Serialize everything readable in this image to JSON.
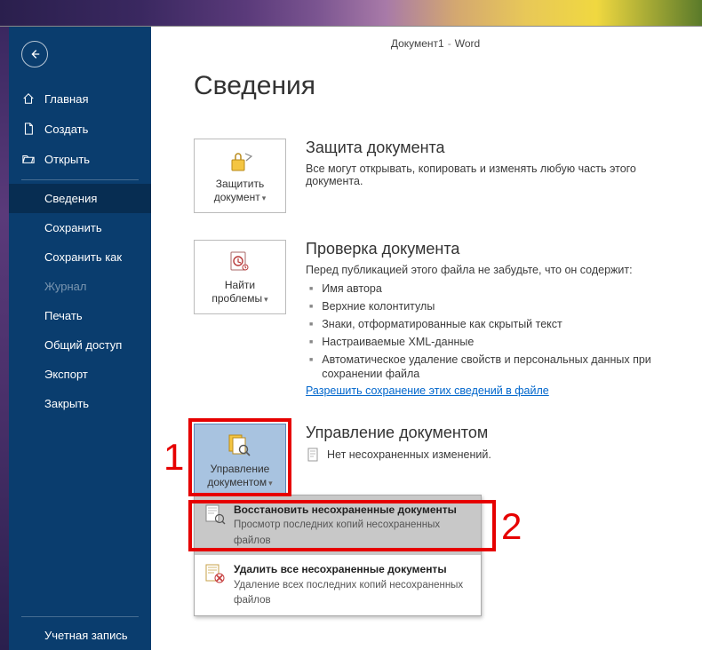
{
  "titlebar": {
    "doc": "Документ1",
    "separator": "-",
    "app": "Word"
  },
  "sidebar": {
    "home": "Главная",
    "new": "Создать",
    "open": "Открыть",
    "info": "Сведения",
    "save": "Сохранить",
    "saveas": "Сохранить как",
    "history": "Журнал",
    "print": "Печать",
    "share": "Общий доступ",
    "export": "Экспорт",
    "close": "Закрыть",
    "account": "Учетная запись"
  },
  "page": {
    "title": "Сведения"
  },
  "protect": {
    "tile_label": "Защитить документ",
    "heading": "Защита документа",
    "body": "Все могут открывать, копировать и изменять любую часть этого документа."
  },
  "inspect": {
    "tile_label": "Найти проблемы",
    "heading": "Проверка документа",
    "body": "Перед публикацией этого файла не забудьте, что он содержит:",
    "items": [
      "Имя автора",
      "Верхние колонтитулы",
      "Знаки, отформатированные как скрытый текст",
      "Настраиваемые XML-данные",
      "Автоматическое удаление свойств и персональных данных при сохранении файла"
    ],
    "link": "Разрешить сохранение этих сведений в файле"
  },
  "manage": {
    "tile_label": "Управление документом",
    "heading": "Управление документом",
    "body": "Нет несохраненных изменений.",
    "dropdown": [
      {
        "title": "Восстановить несохраненные документы",
        "desc": "Просмотр последних копий несохраненных файлов"
      },
      {
        "title": "Удалить все несохраненные документы",
        "desc": "Удаление всех последних копий несохраненных файлов"
      }
    ]
  },
  "annotations": {
    "num1": "1",
    "num2": "2"
  }
}
